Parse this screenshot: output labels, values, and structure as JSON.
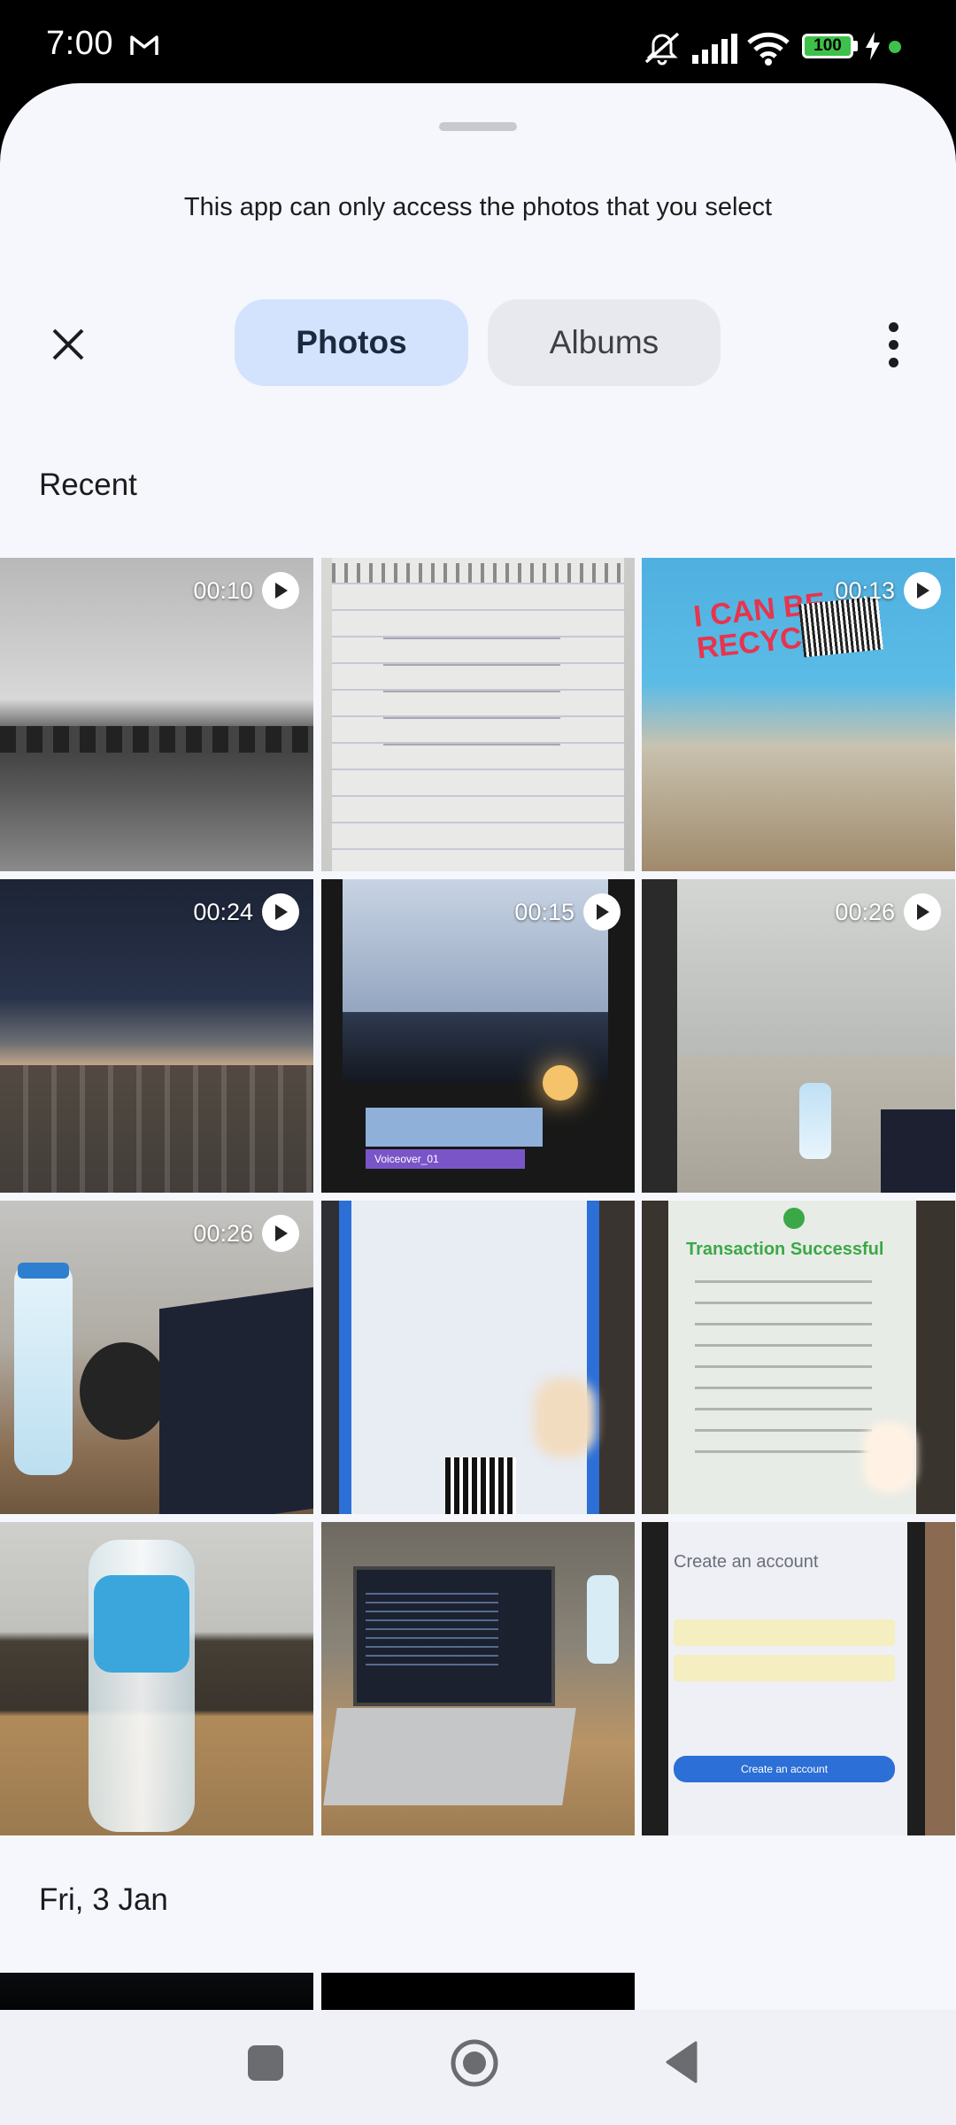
{
  "status_bar": {
    "time": "7:00",
    "notification_icon": "gmail-icon",
    "battery": "100",
    "icons": [
      "mute-icon",
      "signal-icon",
      "wifi-icon",
      "battery-icon",
      "charging-icon"
    ]
  },
  "sheet": {
    "notice": "This app can only access the photos that you select"
  },
  "toolbar": {
    "close_icon": "close-icon",
    "tabs": [
      {
        "label": "Photos",
        "selected": true
      },
      {
        "label": "Albums",
        "selected": false
      }
    ],
    "more_icon": "more-vertical-icon"
  },
  "sections": [
    {
      "title": "Recent",
      "items": [
        {
          "type": "video",
          "duration": "00:10",
          "desc": "grayscale field"
        },
        {
          "type": "photo",
          "desc": "notebook page"
        },
        {
          "type": "video",
          "duration": "00:13",
          "desc": "recyclable bottle label"
        },
        {
          "type": "video",
          "duration": "00:24",
          "desc": "laptop keyboard"
        },
        {
          "type": "video",
          "duration": "00:15",
          "desc": "phone video editor"
        },
        {
          "type": "video",
          "duration": "00:26",
          "desc": "office corridor"
        },
        {
          "type": "video",
          "duration": "00:26",
          "desc": "desk with bottle and laptop"
        },
        {
          "type": "photo",
          "desc": "phone payment screen"
        },
        {
          "type": "photo",
          "desc": "transaction successful screen"
        },
        {
          "type": "photo",
          "desc": "water bottle on desk"
        },
        {
          "type": "photo",
          "desc": "laptop with code"
        },
        {
          "type": "photo",
          "desc": "create account screen"
        }
      ]
    },
    {
      "title": "Fri, 3 Jan",
      "items": [
        {
          "type": "photo",
          "desc": "dark photo"
        },
        {
          "type": "photo",
          "desc": "dark photo"
        }
      ]
    }
  ],
  "tile_text": {
    "recycle_label": "I CAN BE RECYCLED",
    "voiceover": "Voiceover_01",
    "transaction": "Transaction Successful",
    "create_account": "Create an account",
    "create_btn": "Create an account"
  },
  "nav_bar": {
    "icons": [
      "recents-square-icon",
      "home-circle-icon",
      "back-triangle-icon"
    ]
  }
}
